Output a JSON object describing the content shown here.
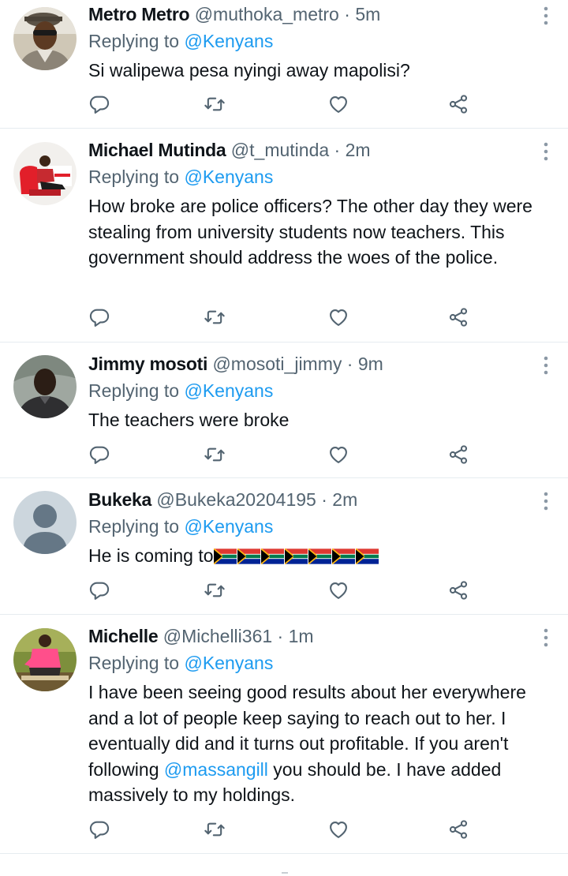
{
  "tweets": [
    {
      "name": "Metro Metro",
      "handle": "@muthoka_metro",
      "time": "5m",
      "replying_prefix": "Replying to",
      "replying_to": "@Kenyans",
      "text": "Si walipewa pesa nyingi away mapolisi?"
    },
    {
      "name": "Michael Mutinda",
      "handle": "@t_mutinda",
      "time": "2m",
      "replying_prefix": "Replying to",
      "replying_to": "@Kenyans",
      "text": "How broke are police officers? The other day they were stealing from university students now teachers. This government should address the woes of the police."
    },
    {
      "name": "Jimmy mosoti",
      "handle": "@mosoti_jimmy",
      "time": "9m",
      "replying_prefix": "Replying to",
      "replying_to": "@Kenyans",
      "text": "The teachers were broke"
    },
    {
      "name": "Bukeka",
      "handle": "@Bukeka20204195",
      "time": "2m",
      "replying_prefix": "Replying to",
      "replying_to": "@Kenyans",
      "text": "He is coming to",
      "emoji_flag_count": 7
    },
    {
      "name": "Michelle",
      "handle": "@Michelli361",
      "time": "1m",
      "replying_prefix": "Replying to",
      "replying_to": "@Kenyans",
      "text_before": "I have been seeing good results about her everywhere and a lot of people keep saying to reach out to her. I eventually did and it turns out profitable. If you aren't following ",
      "text_mention": "@massangill",
      "text_after": " you should be. I have added massively to my holdings."
    }
  ],
  "separator": "·",
  "colors": {
    "text": "#0f1419",
    "secondary": "#536471",
    "link": "#1d9bf0",
    "divider": "#e6ecf0"
  },
  "icons": {
    "reply": "reply-icon",
    "retweet": "retweet-icon",
    "like": "like-icon",
    "share": "share-icon",
    "more": "more-options-icon"
  }
}
